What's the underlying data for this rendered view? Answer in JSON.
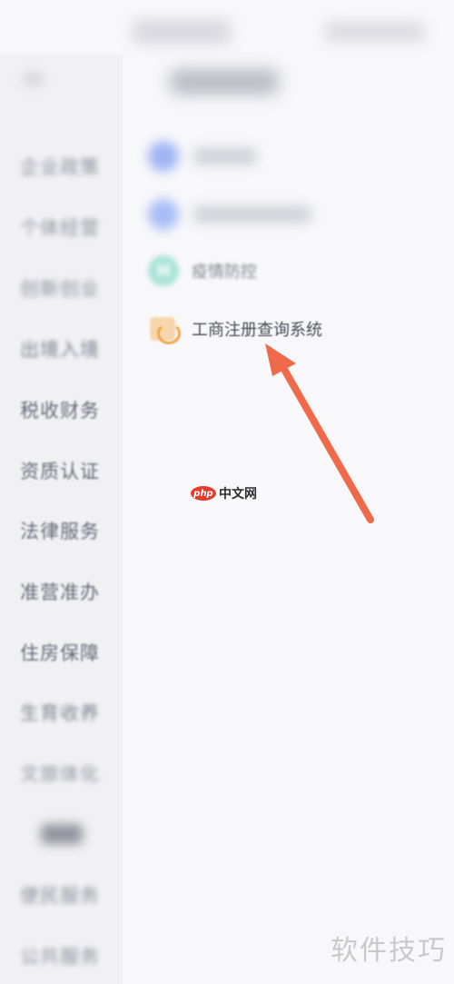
{
  "sidebar": {
    "items": [
      {
        "label": "企业政策"
      },
      {
        "label": "个体经营"
      },
      {
        "label": "创新创业"
      },
      {
        "label": "出境入境"
      },
      {
        "label": "税收财务"
      },
      {
        "label": "资质认证"
      },
      {
        "label": "法律服务"
      },
      {
        "label": "准营准办"
      },
      {
        "label": "住房保障"
      },
      {
        "label": "生育收养"
      },
      {
        "label": "文旅体化"
      },
      {
        "label": "便民服务"
      },
      {
        "label": "公共服务"
      }
    ]
  },
  "main": {
    "items": [
      {
        "label": "疫情防控",
        "icon": "hospital-icon"
      },
      {
        "label": "工商注册查询系统",
        "icon": "business-registry-icon"
      }
    ]
  },
  "watermark": {
    "php_logo": "php",
    "php_text": "中文网",
    "bottom": "软件技巧"
  },
  "colors": {
    "arrow": "#ef6a4b",
    "teal_icon": "#a9e3d6",
    "orange_icon": "#f1a64a"
  }
}
